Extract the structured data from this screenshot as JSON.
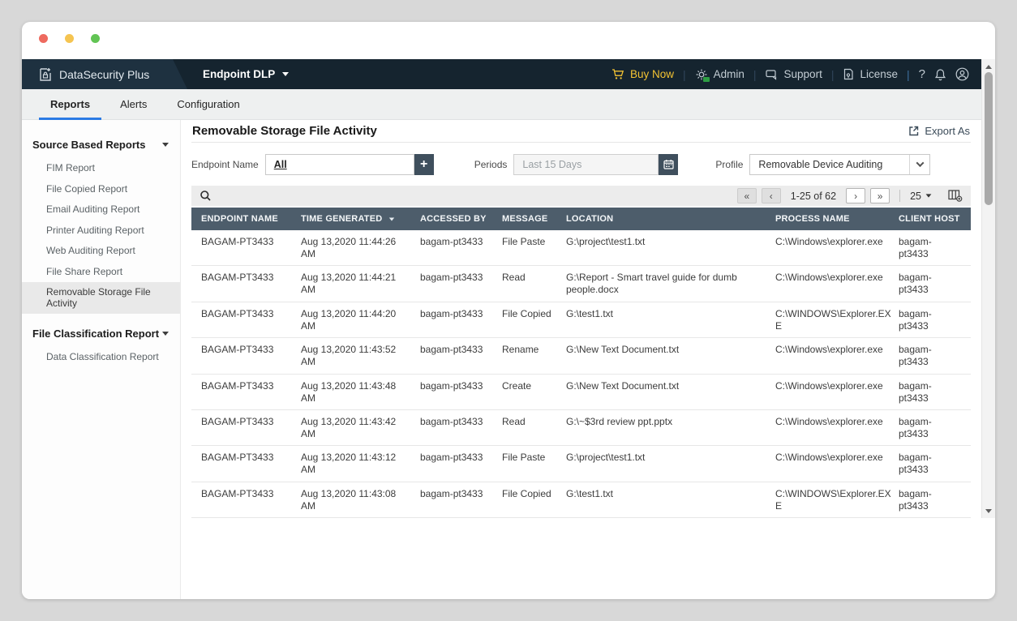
{
  "colors": {
    "navbar_bg": "#15242f",
    "navbar_brand_bg": "#1e3140",
    "buy_now_yellow": "#f2c233",
    "tab_accent_blue": "#2b7be4",
    "table_header_bg": "#4d5d6b",
    "traffic_red": "#ee6a5f",
    "traffic_yellow": "#f5c451",
    "traffic_green": "#62c454"
  },
  "navbar": {
    "brand": "DataSecurity Plus",
    "product": "Endpoint DLP",
    "buy_now": "Buy Now",
    "admin": "Admin",
    "support": "Support",
    "license": "License",
    "help": "?"
  },
  "tabs": [
    {
      "label": "Reports",
      "active": true
    },
    {
      "label": "Alerts",
      "active": false
    },
    {
      "label": "Configuration",
      "active": false
    }
  ],
  "sidebar": {
    "sections": [
      {
        "title": "Source Based Reports",
        "items": [
          "FIM Report",
          "File Copied Report",
          "Email Auditing Report",
          "Printer Auditing Report",
          "Web Auditing Report",
          "File Share Report",
          "Removable Storage File Activity"
        ],
        "selected": "Removable Storage File Activity"
      },
      {
        "title": "File Classification Report",
        "items": [
          "Data Classification Report"
        ],
        "selected": ""
      }
    ]
  },
  "report": {
    "title": "Removable Storage File Activity",
    "export_label": "Export As",
    "filters": {
      "endpoint_label": "Endpoint Name",
      "endpoint_value": "All",
      "periods_label": "Periods",
      "periods_value": "Last 15 Days",
      "profile_label": "Profile",
      "profile_value": "Removable Device Auditing"
    },
    "pagination": {
      "range": "1-25 of 62",
      "page_size": "25",
      "first": "«",
      "prev": "‹",
      "next": "›",
      "last": "»"
    },
    "table": {
      "columns": [
        "ENDPOINT NAME",
        "TIME GENERATED",
        "ACCESSED BY",
        "MESSAGE",
        "LOCATION",
        "PROCESS NAME",
        "CLIENT HOST"
      ],
      "column_keys": [
        "endpoint-name",
        "time-generated",
        "accessed-by",
        "message",
        "location",
        "process-name",
        "client-host"
      ],
      "sorted_column": "TIME GENERATED",
      "rows": [
        [
          "BAGAM-PT3433",
          "Aug 13,2020 11:44:26 AM",
          "bagam-pt3433",
          "File Paste",
          "G:\\project\\test1.txt",
          "C:\\Windows\\explorer.exe",
          "bagam-pt3433"
        ],
        [
          "BAGAM-PT3433",
          "Aug 13,2020 11:44:21 AM",
          "bagam-pt3433",
          "Read",
          "G:\\Report - Smart travel guide for dumb people.docx",
          "C:\\Windows\\explorer.exe",
          "bagam-pt3433"
        ],
        [
          "BAGAM-PT3433",
          "Aug 13,2020 11:44:20 AM",
          "bagam-pt3433",
          "File Copied",
          "G:\\test1.txt",
          "C:\\WINDOWS\\Explorer.EXE",
          "bagam-pt3433"
        ],
        [
          "BAGAM-PT3433",
          "Aug 13,2020 11:43:52 AM",
          "bagam-pt3433",
          "Rename",
          "G:\\New Text Document.txt",
          "C:\\Windows\\explorer.exe",
          "bagam-pt3433"
        ],
        [
          "BAGAM-PT3433",
          "Aug 13,2020 11:43:48 AM",
          "bagam-pt3433",
          "Create",
          "G:\\New Text Document.txt",
          "C:\\Windows\\explorer.exe",
          "bagam-pt3433"
        ],
        [
          "BAGAM-PT3433",
          "Aug 13,2020 11:43:42 AM",
          "bagam-pt3433",
          "Read",
          "G:\\~$3rd review ppt.pptx",
          "C:\\Windows\\explorer.exe",
          "bagam-pt3433"
        ],
        [
          "BAGAM-PT3433",
          "Aug 13,2020 11:43:12 AM",
          "bagam-pt3433",
          "File Paste",
          "G:\\project\\test1.txt",
          "C:\\Windows\\explorer.exe",
          "bagam-pt3433"
        ],
        [
          "BAGAM-PT3433",
          "Aug 13,2020 11:43:08 AM",
          "bagam-pt3433",
          "File Copied",
          "G:\\test1.txt",
          "C:\\WINDOWS\\Explorer.EXE",
          "bagam-pt3433"
        ]
      ]
    }
  }
}
